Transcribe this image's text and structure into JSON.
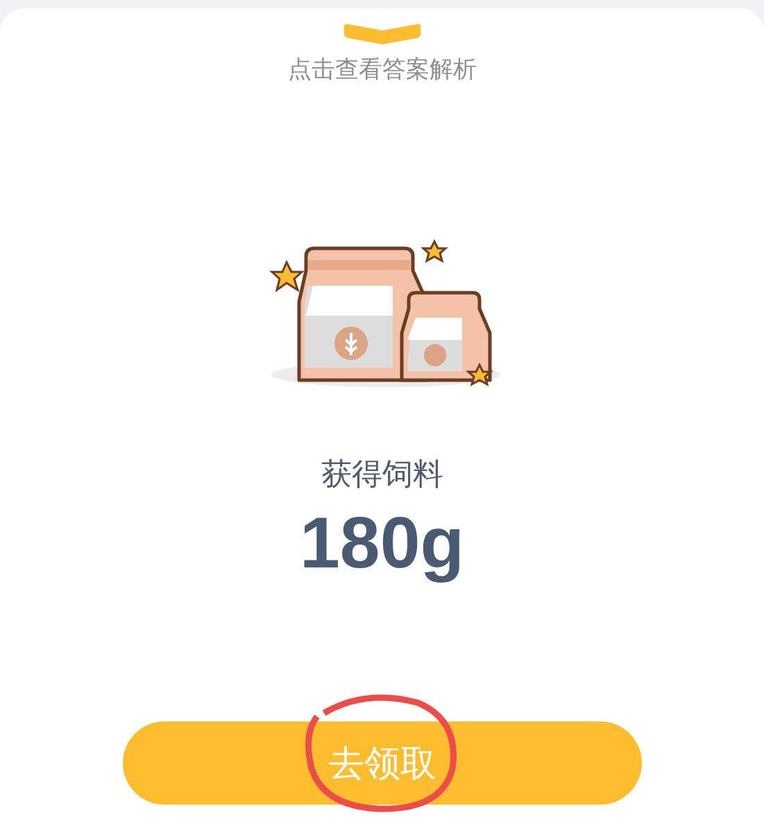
{
  "expand_hint": {
    "label": "点击查看答案解析"
  },
  "reward": {
    "title": "获得饲料",
    "amount": "180g"
  },
  "claim_button": {
    "label": "去领取"
  }
}
